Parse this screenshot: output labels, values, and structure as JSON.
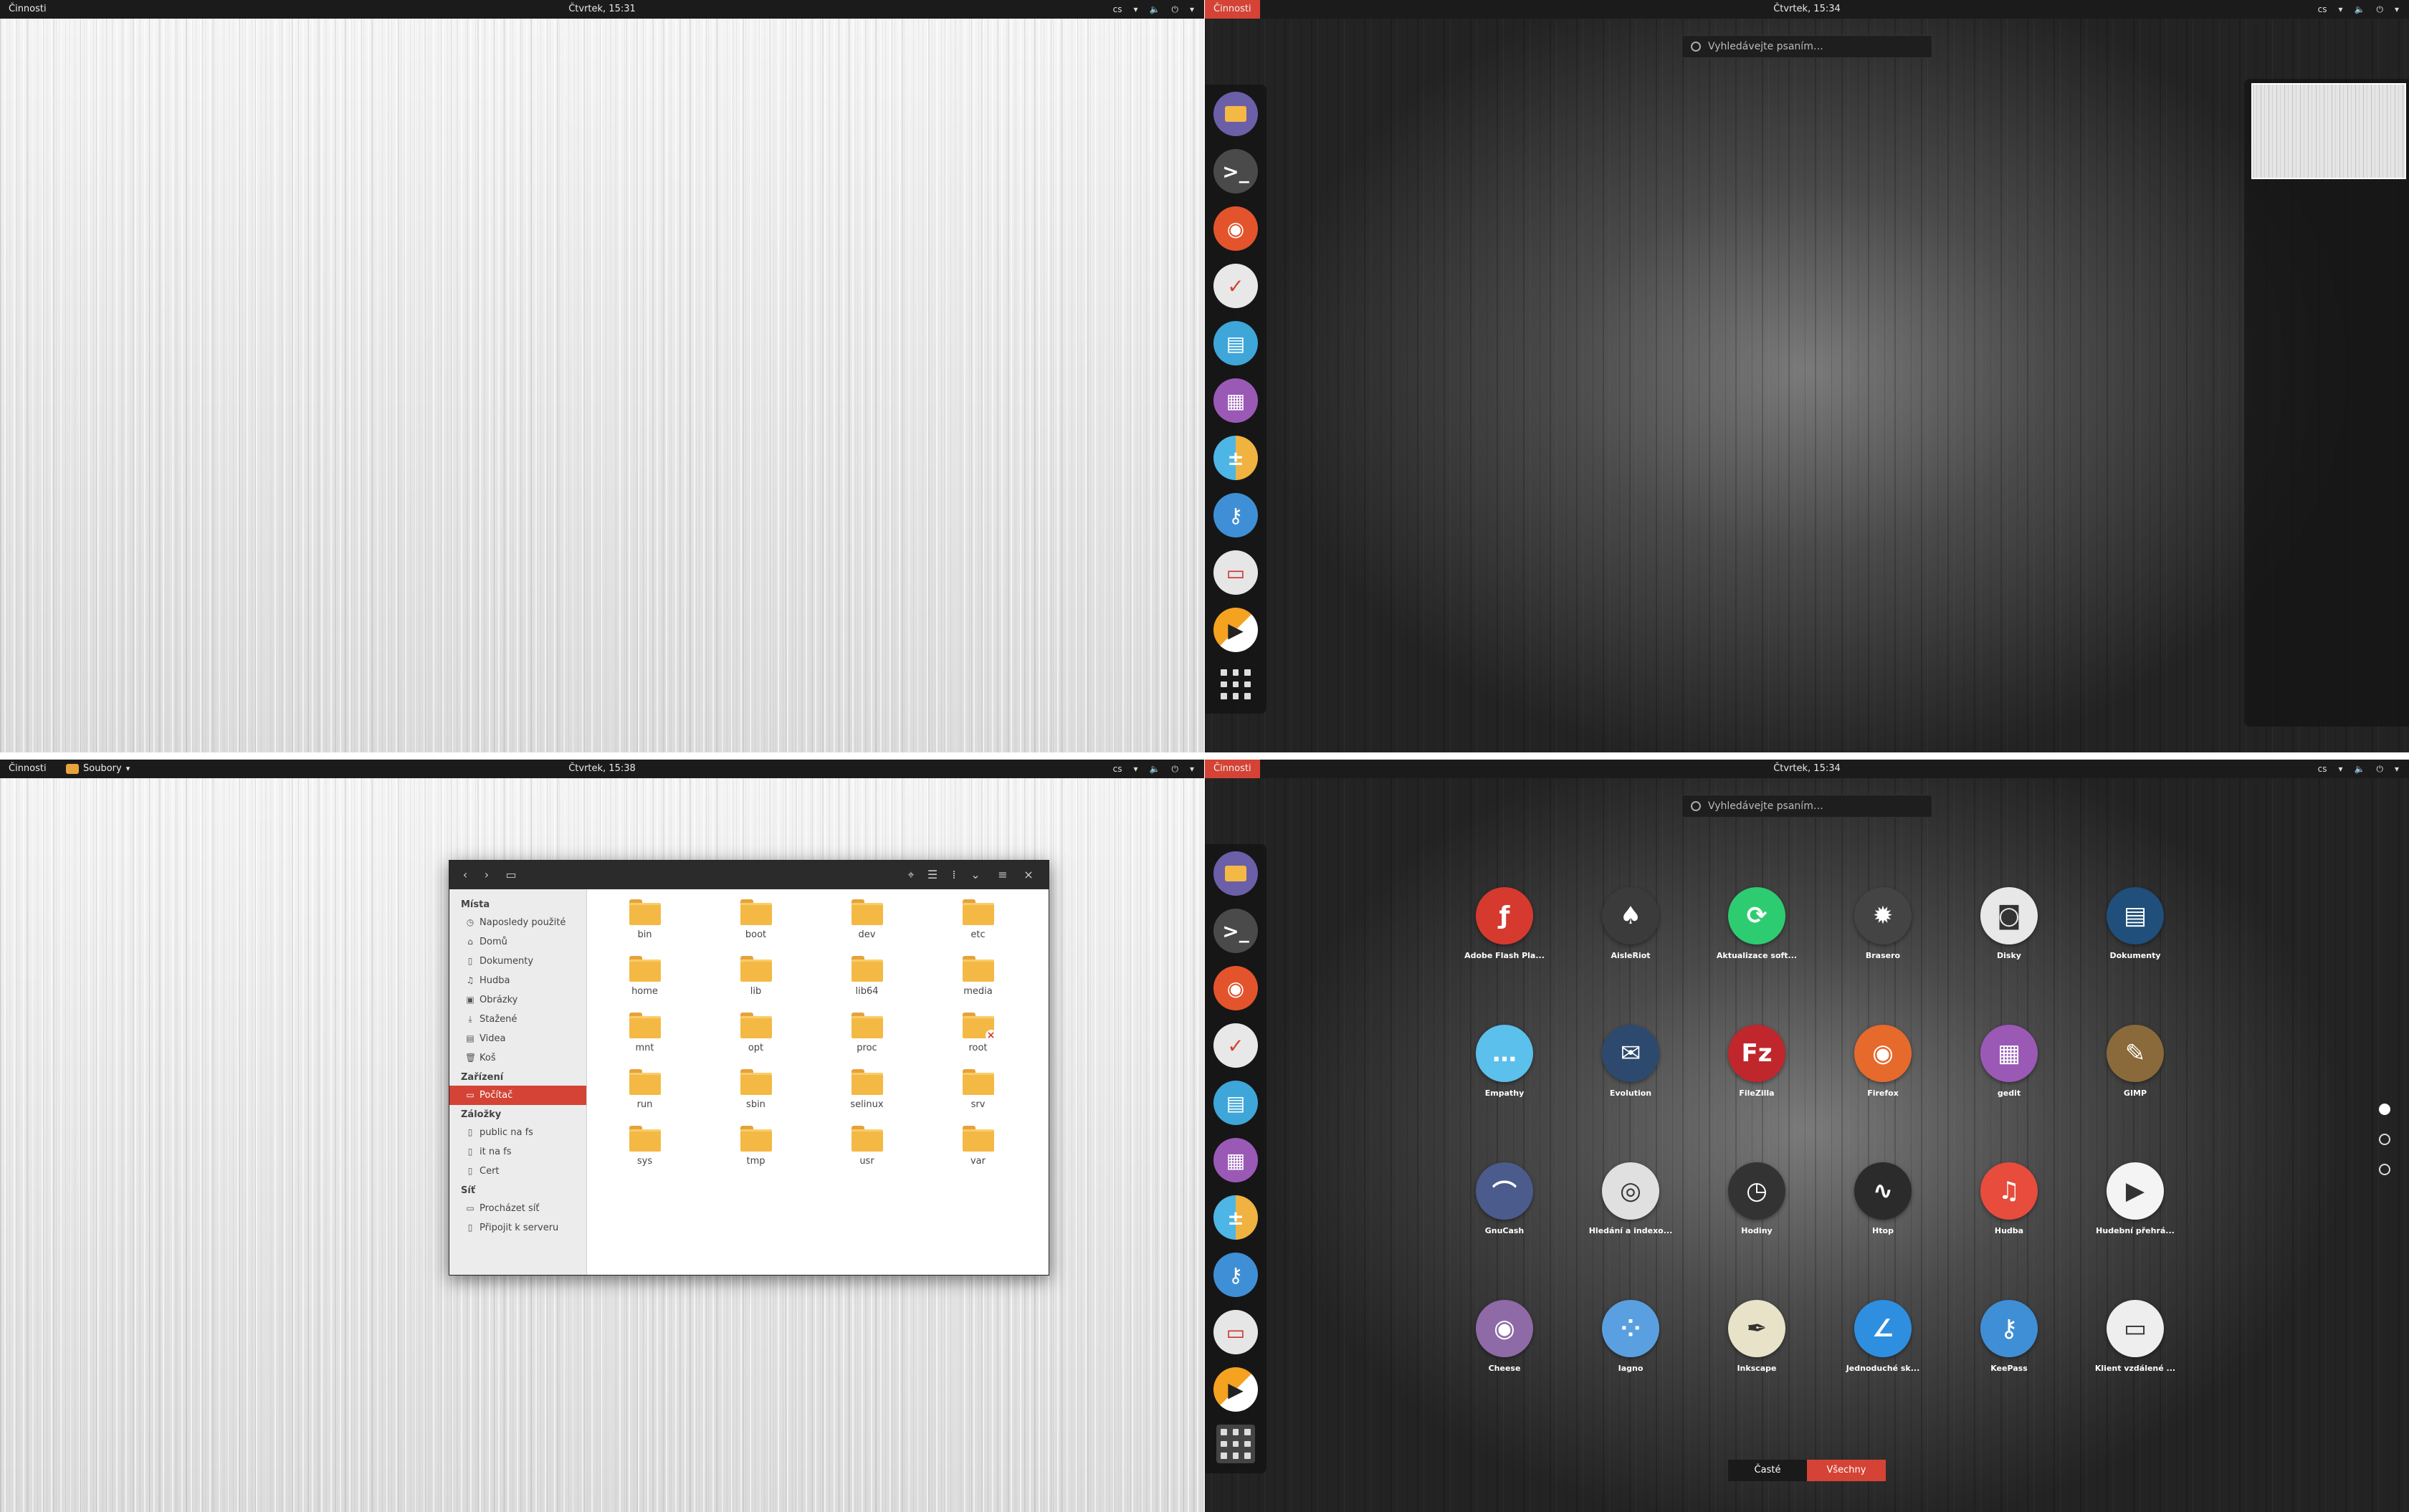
{
  "panels": {
    "q1": {
      "activities": "Činnosti",
      "clock": "Čtvrtek, 15:31",
      "lang": "cs"
    },
    "q2": {
      "activities": "Činnosti",
      "clock": "Čtvrtek, 15:34",
      "lang": "cs"
    },
    "q3": {
      "activities": "Činnosti",
      "app_menu": "Soubory",
      "clock": "Čtvrtek, 15:38",
      "lang": "cs"
    },
    "q4": {
      "activities": "Činnosti",
      "clock": "Čtvrtek, 15:34",
      "lang": "cs"
    }
  },
  "search": {
    "placeholder": "Vyhledávejte psaním…"
  },
  "dash": [
    {
      "icon": "files-icon",
      "color": "#6b5fa8"
    },
    {
      "icon": "terminal-icon",
      "color": "#4a4a4a"
    },
    {
      "icon": "firefox-icon",
      "color": "#e3542c"
    },
    {
      "icon": "tasks-icon",
      "color": "#e8e8e8"
    },
    {
      "icon": "document-icon",
      "color": "#3ea6d9"
    },
    {
      "icon": "text-editor-icon",
      "color": "#9b59b6"
    },
    {
      "icon": "calculator-icon",
      "color": "#4db6e6"
    },
    {
      "icon": "keys-icon",
      "color": "#3f8fd6"
    },
    {
      "icon": "remote-desktop-icon",
      "color": "#e6e6e6"
    },
    {
      "icon": "media-player-icon",
      "color": "#f4a21f"
    }
  ],
  "files": {
    "sidebar": {
      "places_header": "Místa",
      "places": [
        "Naposledy použité",
        "Domů",
        "Dokumenty",
        "Hudba",
        "Obrázky",
        "Stažené",
        "Videa",
        "Koš"
      ],
      "devices_header": "Zařízení",
      "devices": [
        "Počítač"
      ],
      "bookmarks_header": "Záložky",
      "bookmarks": [
        "public na fs",
        "it na fs",
        "Cert"
      ],
      "network_header": "Síť",
      "network": [
        "Procházet síť",
        "Připojit k serveru"
      ]
    },
    "folders": [
      "bin",
      "boot",
      "dev",
      "etc",
      "home",
      "lib",
      "lib64",
      "media",
      "mnt",
      "opt",
      "proc",
      "root",
      "run",
      "sbin",
      "selinux",
      "srv",
      "sys",
      "tmp",
      "usr",
      "var"
    ]
  },
  "apps": [
    {
      "label": "Adobe Flash Pla...",
      "color": "#d63a2f",
      "glyph": "ƒ"
    },
    {
      "label": "AisleRiot",
      "color": "#3b3b3b",
      "glyph": "♠"
    },
    {
      "label": "Aktualizace soft...",
      "color": "#2ecc71",
      "glyph": "⟳"
    },
    {
      "label": "Brasero",
      "color": "#444444",
      "glyph": "✹"
    },
    {
      "label": "Disky",
      "color": "#e8e8e8",
      "glyph": "◙"
    },
    {
      "label": "Dokumenty",
      "color": "#1f4f7a",
      "glyph": "▤"
    },
    {
      "label": "Empathy",
      "color": "#5bc0eb",
      "glyph": "…"
    },
    {
      "label": "Evolution",
      "color": "#2d4a6e",
      "glyph": "✉"
    },
    {
      "label": "FileZilla",
      "color": "#c0272d",
      "glyph": "Fz"
    },
    {
      "label": "Firefox",
      "color": "#e66a2c",
      "glyph": "◉"
    },
    {
      "label": "gedit",
      "color": "#9b59b6",
      "glyph": "▦"
    },
    {
      "label": "GIMP",
      "color": "#8a6a3a",
      "glyph": "✎"
    },
    {
      "label": "GnuCash",
      "color": "#4b5b8c",
      "glyph": "⌒"
    },
    {
      "label": "Hledání a indexo...",
      "color": "#e0e0e0",
      "glyph": "◎"
    },
    {
      "label": "Hodiny",
      "color": "#333333",
      "glyph": "◷"
    },
    {
      "label": "Htop",
      "color": "#2b2b2b",
      "glyph": "∿"
    },
    {
      "label": "Hudba",
      "color": "#e74c3c",
      "glyph": "♫"
    },
    {
      "label": "Hudební přehrá...",
      "color": "#f4f4f4",
      "glyph": "▶"
    },
    {
      "label": "Cheese",
      "color": "#8e6aa6",
      "glyph": "◉"
    },
    {
      "label": "Iagno",
      "color": "#5aa0e0",
      "glyph": "⁘"
    },
    {
      "label": "Inkscape",
      "color": "#e8e2c8",
      "glyph": "✒"
    },
    {
      "label": "Jednoduché sk...",
      "color": "#2e8fe0",
      "glyph": "∠"
    },
    {
      "label": "KeePass",
      "color": "#3f8fd6",
      "glyph": "⚷"
    },
    {
      "label": "Klient vzdálené ...",
      "color": "#eeeeee",
      "glyph": "▭"
    }
  ],
  "view_toggle": {
    "frequent": "Časté",
    "all": "Všechny"
  }
}
